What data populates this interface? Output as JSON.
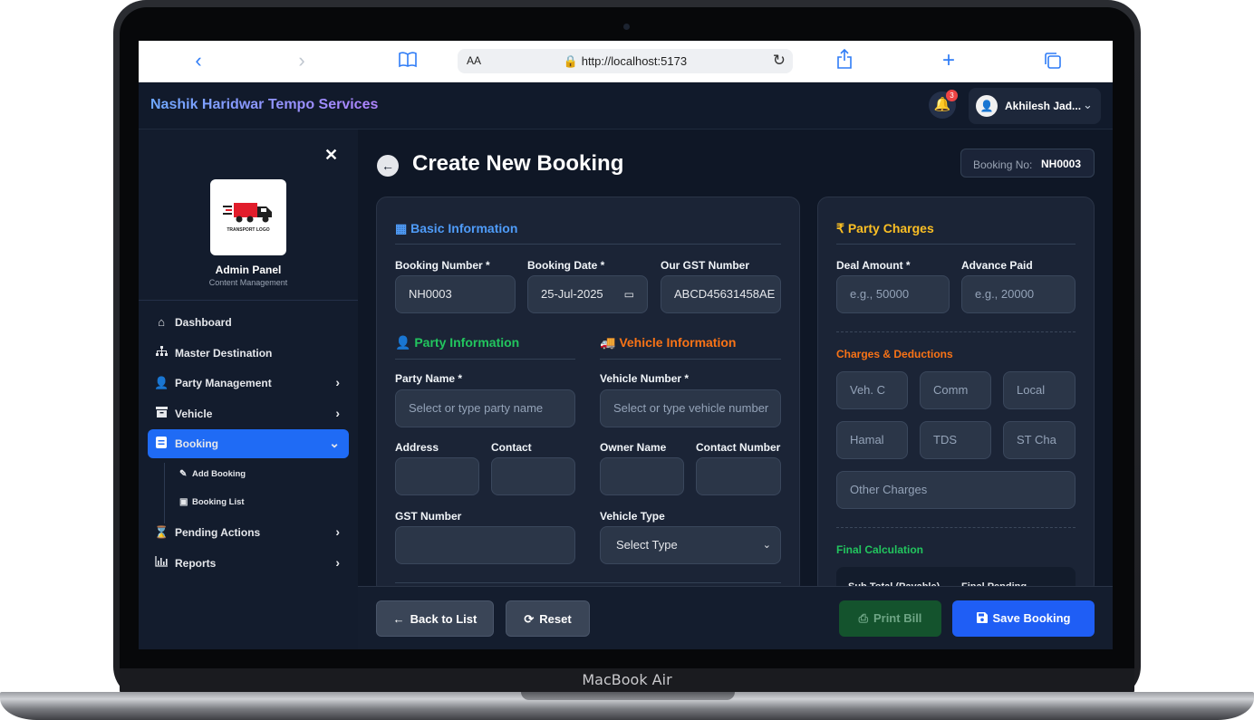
{
  "device": {
    "label": "MacBook Air"
  },
  "browser": {
    "url": "http://localhost:5173",
    "text_size_label": "AA",
    "icons": [
      "back-icon",
      "forward-icon",
      "bookmarks-icon",
      "lock-icon",
      "reload-icon",
      "share-icon",
      "new-tab-icon",
      "tabs-icon"
    ]
  },
  "header": {
    "brand": "Nashik Haridwar Tempo Services",
    "notification_count": "3",
    "user_name": "Akhilesh Jad..."
  },
  "sidebar": {
    "logo_text": "TRANSPORT LOGO",
    "title": "Admin Panel",
    "subtitle": "Content Management",
    "items": [
      {
        "label": "Dashboard",
        "icon": "home-icon"
      },
      {
        "label": "Master Destination",
        "icon": "sitemap-icon"
      },
      {
        "label": "Party Management",
        "icon": "user-edit-icon"
      },
      {
        "label": "Vehicle",
        "icon": "archive-icon"
      },
      {
        "label": "Booking",
        "icon": "booking-icon"
      },
      {
        "label": "Pending Actions",
        "icon": "hourglass-icon"
      },
      {
        "label": "Reports",
        "icon": "chart-icon"
      }
    ],
    "sub_items": [
      {
        "label": "Add Booking",
        "icon": "edit-icon"
      },
      {
        "label": "Booking List",
        "icon": "briefcase-icon"
      }
    ]
  },
  "page": {
    "title": "Create New Booking",
    "booking_no_label": "Booking No:",
    "booking_no_value": "NH0003"
  },
  "basic_info": {
    "title": "Basic Information",
    "booking_number_label": "Booking Number *",
    "booking_number_value": "NH0003",
    "booking_date_label": "Booking Date *",
    "booking_date_value": "25-Jul-2025",
    "gst_label": "Our GST Number",
    "gst_value": "ABCD45631458AE"
  },
  "party_info": {
    "title": "Party Information",
    "party_name_label": "Party Name *",
    "party_name_placeholder": "Select or type party name",
    "address_label": "Address",
    "contact_label": "Contact",
    "gst_label": "GST Number"
  },
  "vehicle_info": {
    "title": "Vehicle Information",
    "vehicle_number_label": "Vehicle Number *",
    "vehicle_number_placeholder": "Select or type vehicle number",
    "owner_label": "Owner Name",
    "contact_label": "Contact Number",
    "type_label": "Vehicle Type",
    "type_value": "Select Type"
  },
  "party_charges": {
    "title": "Party Charges",
    "deal_amount_label": "Deal Amount *",
    "deal_amount_placeholder": "e.g., 50000",
    "advance_label": "Advance Paid",
    "advance_placeholder": "e.g., 20000",
    "deductions_title": "Charges & Deductions",
    "deduction_placeholders": [
      "Veh. C",
      "Comm",
      "Local",
      "Hamal",
      "TDS",
      "ST Cha"
    ],
    "other_placeholder": "Other Charges",
    "final_title": "Final Calculation",
    "subtotal_label": "Sub Total (Payable)",
    "final_pending_label": "Final Pending"
  },
  "actions": {
    "back": "Back to List",
    "reset": "Reset",
    "print": "Print Bill",
    "save": "Save Booking"
  },
  "colors": {
    "basic_title": "#4f9cf9",
    "party_title": "#22c55e",
    "vehicle_title": "#f97316",
    "charges_title": "#fbbf24",
    "deductions_title": "#f97316",
    "final_title": "#22c55e",
    "primary": "#1f5ef5"
  }
}
